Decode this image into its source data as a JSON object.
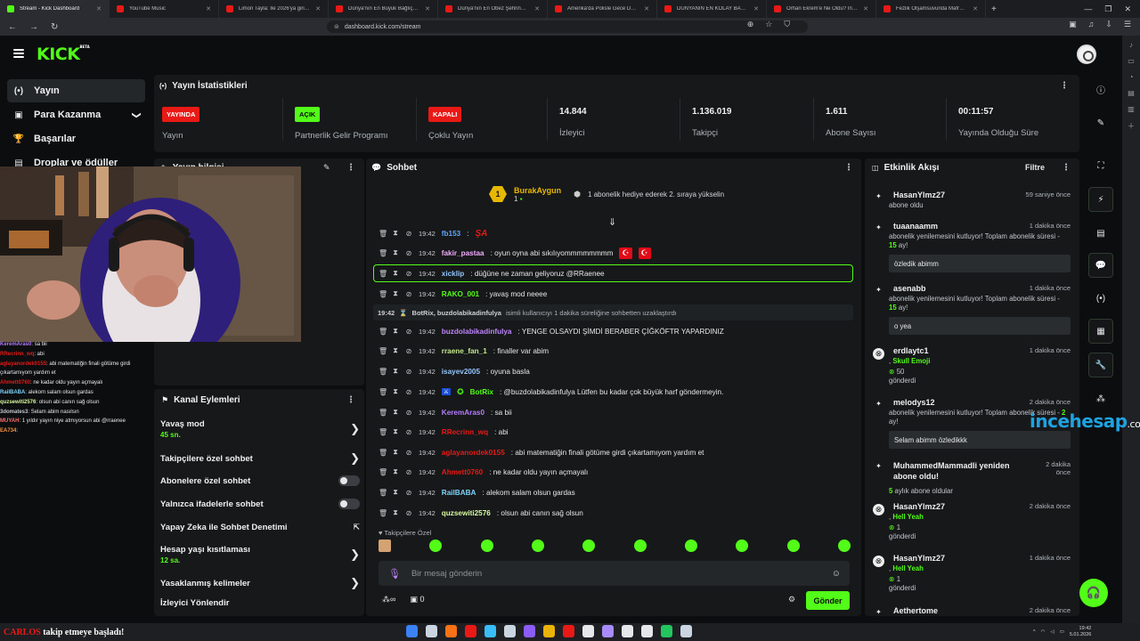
{
  "browser": {
    "tabs": [
      {
        "title": "Stream - Kick Dashboard",
        "active": true,
        "color": "#53fc18"
      },
      {
        "title": "YouTube Music",
        "color": "#e91916"
      },
      {
        "title": "Limon Tayla: İle 2026'ya giriş partisi -",
        "color": "#e91916"
      },
      {
        "title": "Dünya'nın En Büyük Bağlıç Balına Kü",
        "color": "#e91916"
      },
      {
        "title": "Dünya'nın En Obez Şehrinde 24 Saat",
        "color": "#e91916"
      },
      {
        "title": "Amerika'da Polisle Gece Devriyesine",
        "color": "#e91916"
      },
      {
        "title": "DÜNYANIN EN KOLAY BANKA SOYGU",
        "color": "#e91916"
      },
      {
        "title": "Orhan Ekrem'e Ne Oldu? İngiltere'de",
        "color": "#e91916"
      },
      {
        "title": "Fezlik Olşamsuvunda Mafrusız Kaları d",
        "color": "#e91916"
      }
    ],
    "new_tab": "+",
    "url": "dashboard.kick.com/stream"
  },
  "header": {
    "logo": "KICK",
    "logo_sup": "BETA"
  },
  "left_nav": [
    {
      "label": "Yayın",
      "icon": "(•)",
      "selected": true
    },
    {
      "label": "Para Kazanma",
      "icon": "▣",
      "chevron": "❯"
    },
    {
      "label": "Başarılar",
      "icon": "🏆"
    },
    {
      "label": "Droplar ve ödüller",
      "icon": "▤"
    }
  ],
  "stats": {
    "title": "Yayın İstatistikleri",
    "items": [
      {
        "badge": "YAYINDA",
        "badge_color": "red",
        "label": "Yayın"
      },
      {
        "badge": "AÇIK",
        "badge_color": "green",
        "label": "Partnerlik Gelir Programı"
      },
      {
        "badge": "KAPALI",
        "badge_color": "red",
        "label": "Çoklu Yayın"
      },
      {
        "value": "14.844",
        "label": "İzleyici"
      },
      {
        "value": "1.136.019",
        "label": "Takipçi"
      },
      {
        "value": "1.611",
        "label": "Abone Sayısı"
      },
      {
        "value": "00:11:57",
        "label": "Yayında Olduğu Süre"
      }
    ]
  },
  "stream_info": {
    "title": "Yayın bilgisi"
  },
  "overlay_chat": [
    {
      "user": "KeremAras0",
      "text": ": sa bii",
      "color": "#b57cff"
    },
    {
      "user": "RRecrinn_wq",
      "text": ": abi",
      "color": "#e91916"
    },
    {
      "user": "aglayanordek0155",
      "text": ": abi matematiğin finali götüme girdi çıkartamıyom yardım et",
      "color": "#e91916"
    },
    {
      "user": "Ahmett0760",
      "text": ": ne kadar oldu yayın açmayalı",
      "color": "#e91916"
    },
    {
      "user": "RailBABA",
      "text": ": alekom salam olsun gardas",
      "color": "#7dd3fc"
    },
    {
      "user": "quzsewiti2576",
      "text": ": olsun abi canın sağ olsun",
      "color": "#d9f99d"
    },
    {
      "user": "3domates3",
      "text": ": Selam abim nasılsın",
      "color": "#c3c7cb"
    },
    {
      "user": "MUYAH",
      "text": ": 1 yıldır yayın niye atmıyorsun abi @rraenee",
      "color": "#f87171"
    },
    {
      "user": "EA734",
      "text": ":",
      "color": "#fb923c"
    }
  ],
  "actions": {
    "title": "Kanal Eylemleri",
    "items": [
      {
        "label": "Yavaş mod",
        "sub": "45 sn.",
        "control": "chevron"
      },
      {
        "label": "Takipçilere özel sohbet",
        "control": "chevron"
      },
      {
        "label": "Abonelere özel sohbet",
        "control": "toggle"
      },
      {
        "label": "Yalnızca ifadelerle sohbet",
        "control": "toggle"
      },
      {
        "label": "Yapay Zeka ile Sohbet Denetimi",
        "control": "external"
      },
      {
        "label": "Hesap yaşı kısıtlaması",
        "sub": "12 sa.",
        "control": "chevron"
      },
      {
        "label": "Yasaklanmış kelimeler",
        "control": "chevron"
      },
      {
        "label": "İzleyici Yönlendir",
        "control": "none"
      }
    ]
  },
  "chat": {
    "title": "Sohbet",
    "pinned_user": "BurakAygun",
    "pinned_count": "1",
    "pinned_text": "1 abonelik hediye ederek 2. sıraya yükselin",
    "system": {
      "time": "19:42",
      "user": "BotRix, buzdolabikadinfulya",
      "text": "isimli kullanıcıyı 1 dakika süreliğine sohbetten uzaklaştırdı"
    },
    "messages": [
      {
        "time": "19:42",
        "user": "fb153",
        "text": ":",
        "color": "#60a5fa",
        "flag": "SA"
      },
      {
        "time": "19:42",
        "user": "fakir_pastaa",
        "text": ": oyun oyna abi sıkılıyommmmmmmm",
        "color": "#f0abfc",
        "flag": "TR"
      },
      {
        "time": "19:42",
        "user": "xicklip",
        "text": ": düğüne ne zaman geliyoruz @RRaenee",
        "color": "#93c5fd",
        "highlight": true
      },
      {
        "time": "19:42",
        "user": "RAKO_001",
        "text": ": yavaş mod neeee",
        "color": "#53fc18"
      },
      {
        "time": "19:42",
        "user": "buzdolabikadinfulya",
        "text": ": YENGE OLSAYDI ŞİMDİ BERABER ÇİĞKÖFTR YAPARDINIZ",
        "color": "#c084fc"
      },
      {
        "time": "19:42",
        "user": "rraene_fan_1",
        "text": ": finaller var abim",
        "color": "#c3e88d"
      },
      {
        "time": "19:42",
        "user": "isayev2005",
        "text": ": oyuna basla",
        "color": "#93c5fd"
      },
      {
        "time": "19:42",
        "user": "BotRix",
        "text": ": @buzdolabikadinfulya Lütfen bu kadar çok büyük harf göndermeyin.",
        "color": "#53fc18",
        "bot": true
      },
      {
        "time": "19:42",
        "user": "KeremAras0",
        "text": ": sa bii",
        "color": "#b57cff"
      },
      {
        "time": "19:42",
        "user": "RRecrinn_wq",
        "text": ": abi",
        "color": "#e91916"
      },
      {
        "time": "19:42",
        "user": "aglayanordek0155",
        "text": ": abi matematiğin finali götüme girdi çıkartamıyom yardım et",
        "color": "#e91916"
      },
      {
        "time": "19:42",
        "user": "Ahmett0760",
        "text": ": ne kadar oldu yayın açmayalı",
        "color": "#e91916"
      },
      {
        "time": "19:42",
        "user": "RailBABA",
        "text": ": alekom salam olsun gardas",
        "color": "#7dd3fc"
      },
      {
        "time": "19:42",
        "user": "quzsewiti2576",
        "text": ": olsun abi canın sağ olsun",
        "color": "#d9f99d"
      }
    ],
    "follower_only": "Takipçilere Özel",
    "placeholder": "Bir mesaj gönderin",
    "points": "0",
    "send": "Gönder"
  },
  "activity": {
    "title": "Etkinlik Akışı",
    "filter": "Filtre",
    "events": [
      {
        "name": "HasanYlmz27",
        "time": "59 saniye önce",
        "desc": "abone oldu"
      },
      {
        "name": "tuaanaamm",
        "time": "1 dakika önce",
        "desc": "abonelik yenilemesini kutluyor! Toplam abonelik süresi - ",
        "green": "15",
        "after": " ay!",
        "quote": "özledik abimm"
      },
      {
        "name": "asenabb",
        "time": "1 dakika önce",
        "desc": "abonelik yenilemesini kutluyor! Toplam abonelik süresi - ",
        "green": "15",
        "after": " ay!",
        "quote": "o yea"
      },
      {
        "name": "erdlaytc1",
        "time": "1 dakika önce",
        "desc": ", ",
        "green": "Skull Emoji",
        "amount": "50",
        "sent": "gönderdi"
      },
      {
        "name": "melodys12",
        "time": "2 dakika önce",
        "desc": "abonelik yenilemesini kutluyor! Toplam abonelik süresi - ",
        "green": "2",
        "after": " ay!",
        "quote": "Selam abimm özledikkk"
      },
      {
        "name": "MuhammedMammadli yeniden abone oldu!",
        "time": "2 dakika önce",
        "green": "5",
        "after": " aylık abone oldular"
      },
      {
        "name": "HasanYlmz27",
        "time": "2 dakika önce",
        "desc": ", ",
        "green": "Hell Yeah",
        "amount": "1",
        "sent": "gönderdi"
      },
      {
        "name": "HasanYlmz27",
        "time": "1 dakika önce",
        "desc": ", ",
        "green": "Hell Yeah",
        "amount": "1",
        "sent": "gönderdi"
      },
      {
        "name": "Aethertome",
        "time": "2 dakika önce"
      }
    ]
  },
  "watermark": {
    "a": "ince",
    "b": "hesap",
    "c": ".com"
  },
  "taskbar": {
    "follower": "CARLOS",
    "note": "takip etmeye başladı!",
    "time": "19:42",
    "date": "5.01.2026"
  }
}
